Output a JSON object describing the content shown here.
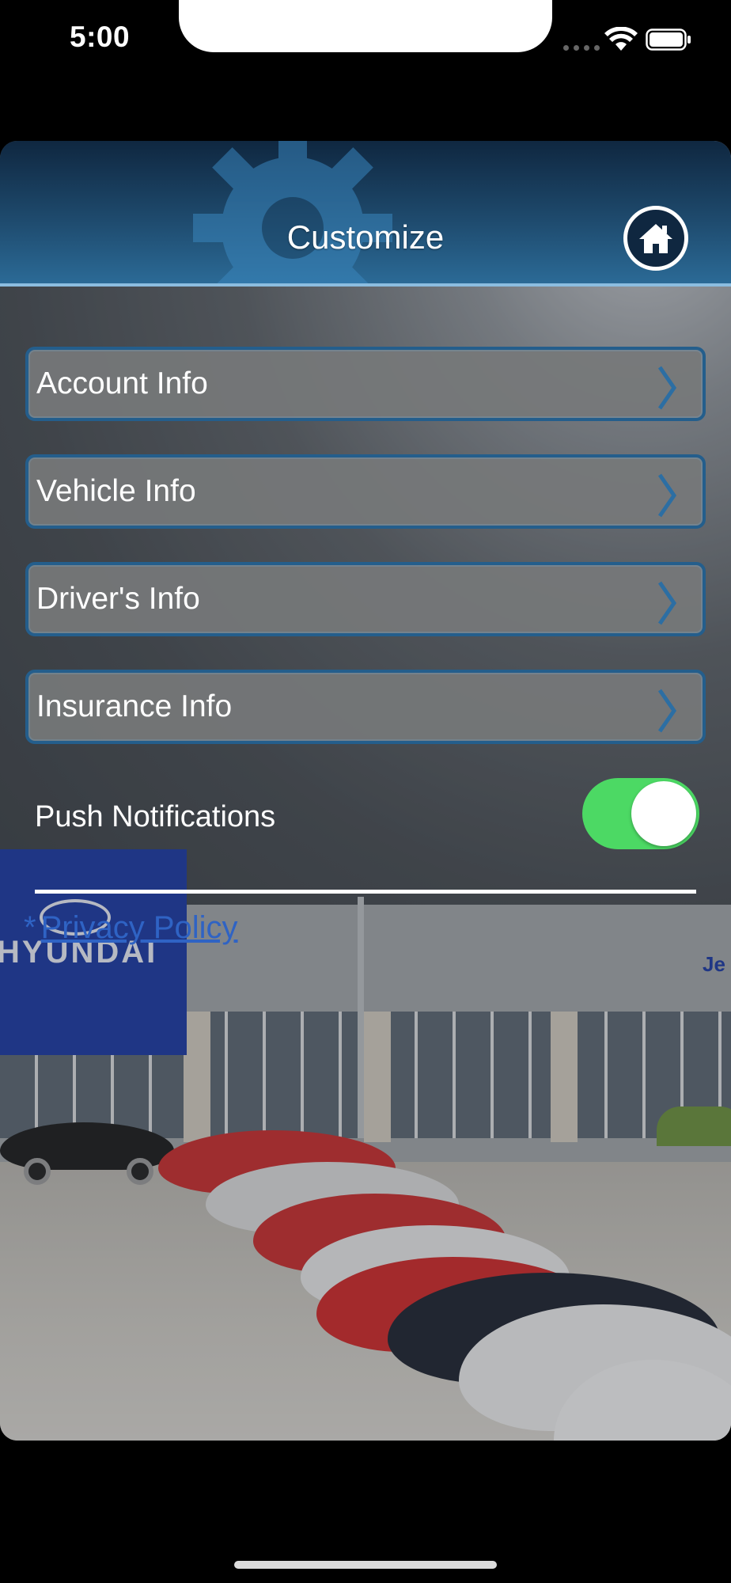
{
  "status_bar": {
    "time": "5:00"
  },
  "header": {
    "title": "Customize"
  },
  "menu": {
    "items": [
      {
        "label": "Account Info"
      },
      {
        "label": "Vehicle Info"
      },
      {
        "label": "Driver's Info"
      },
      {
        "label": "Insurance Info"
      }
    ]
  },
  "settings": {
    "push_notifications_label": "Push Notifications",
    "push_notifications_on": true
  },
  "footer": {
    "privacy_prefix": "*",
    "privacy_link": "Privacy Policy"
  },
  "colors": {
    "toggle_on": "#4cd964",
    "header": "#1e4a6d",
    "border": "#245e8c",
    "link": "#2f63c4"
  },
  "icons": [
    "wifi-icon",
    "battery-icon",
    "home-icon",
    "gear-icon",
    "chevron-right-icon"
  ]
}
